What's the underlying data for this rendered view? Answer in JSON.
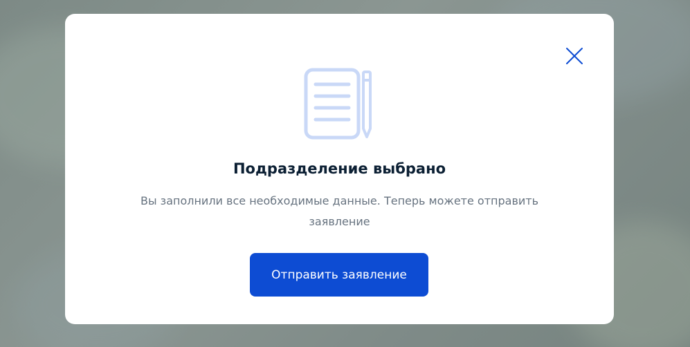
{
  "dialog": {
    "title": "Подразделение выбрано",
    "description": "Вы заполнили все необходимые данные. Теперь можете отправить заявление",
    "submit_label": "Отправить заявление",
    "close_icon": "close-icon",
    "illustration_icon": "document-with-pencil-icon"
  },
  "colors": {
    "primary_button": "#0d4cd3",
    "title_text": "#0b1f33",
    "description_text": "#66727f",
    "close_icon": "#0d4cd3",
    "illustration": "#c9d8f7"
  }
}
